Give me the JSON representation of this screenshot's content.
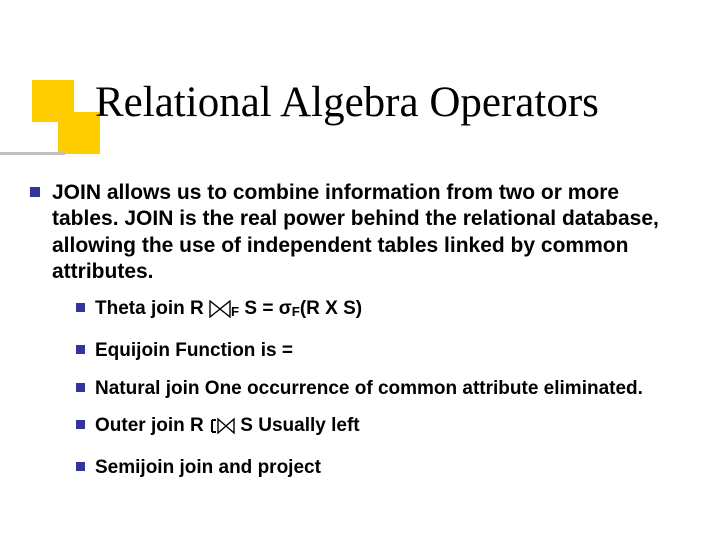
{
  "title": "Relational Algebra Operators",
  "main_text": "JOIN allows us to combine information from two or more tables. JOIN is the real power behind the relational database, allowing the use of independent tables linked by common attributes.",
  "items": [
    {
      "prefix": "Theta join  R ",
      "sym": "theta",
      "mid": " S  =  σ",
      "sub": "F",
      "suffix": "(R X S)"
    },
    {
      "prefix": "Equijoin  Function is ="
    },
    {
      "prefix": "Natural join   One occurrence of common attribute eliminated."
    },
    {
      "prefix": "Outer join R ",
      "sym": "outer",
      "mid": "  S      Usually left"
    },
    {
      "prefix": "Semijoin  join and project"
    }
  ],
  "theta_sub": "F"
}
